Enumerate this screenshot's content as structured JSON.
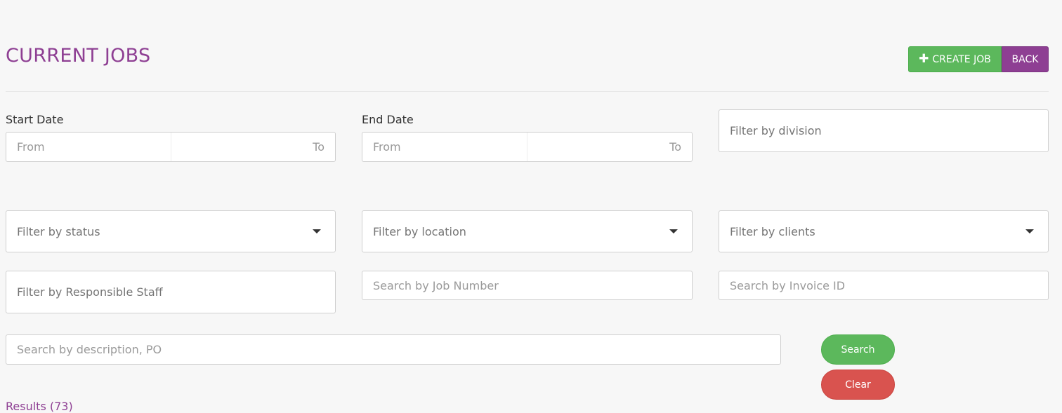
{
  "header": {
    "title": "CURRENT JOBS",
    "create_label": "CREATE JOB",
    "back_label": "BACK"
  },
  "filters": {
    "start_date": {
      "label": "Start Date",
      "from_placeholder": "From",
      "to_placeholder": "To"
    },
    "end_date": {
      "label": "End Date",
      "from_placeholder": "From",
      "to_placeholder": "To"
    },
    "division_placeholder": "Filter by division",
    "status_placeholder": "Filter by status",
    "location_placeholder": "Filter by location",
    "clients_placeholder": "Filter by clients",
    "staff_placeholder": "Filter by Responsible Staff",
    "job_number_placeholder": "Search by Job Number",
    "invoice_placeholder": "Search by Invoice ID",
    "description_placeholder": "Search by description, PO"
  },
  "actions": {
    "search_label": "Search",
    "clear_label": "Clear"
  },
  "results": {
    "label": "Results (73)"
  },
  "colors": {
    "brand_purple": "#8e3f93",
    "success_green": "#5cb85c",
    "danger_red": "#d9534f"
  }
}
